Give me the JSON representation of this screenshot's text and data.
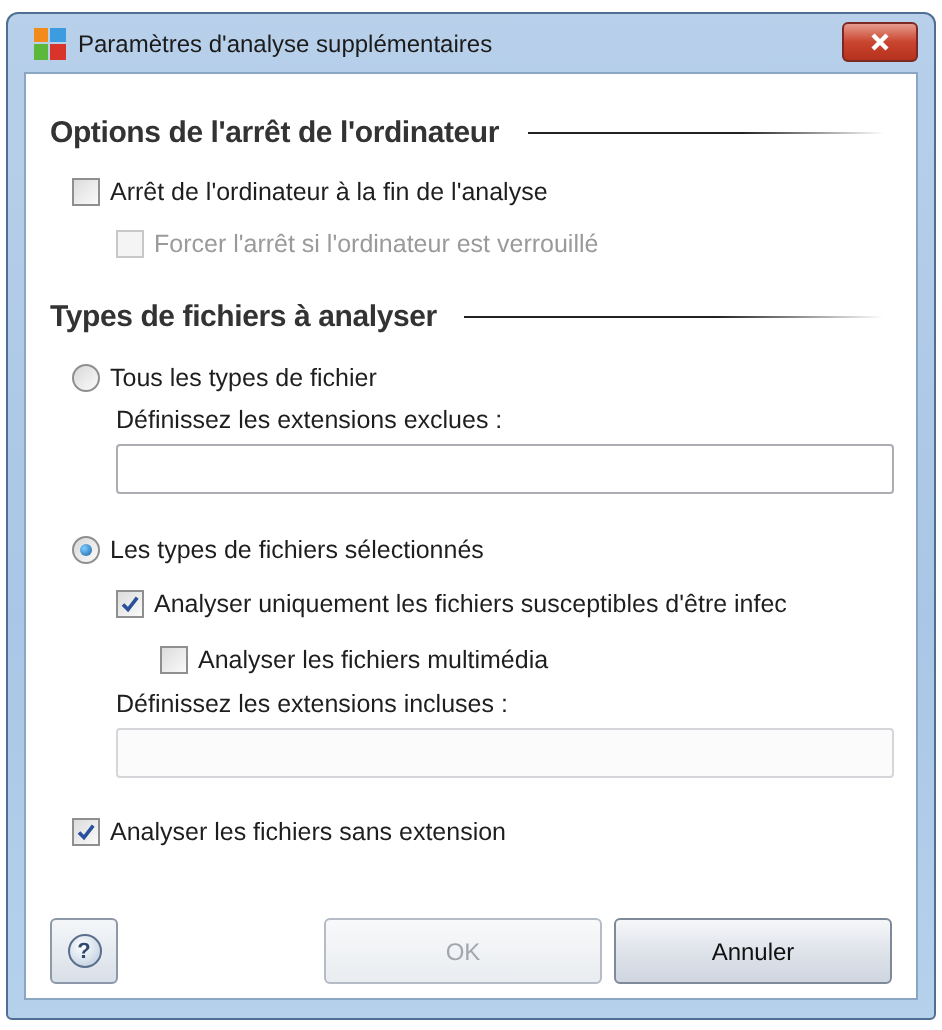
{
  "window": {
    "title": "Paramètres d'analyse supplémentaires"
  },
  "sections": [
    {
      "heading": "Options de l'arrêt de l'ordinateur",
      "items": [
        {
          "kind": "checkbox",
          "label": "Arrêt de l'ordinateur à la fin de l'analyse",
          "checked": false,
          "disabled": false,
          "children": [
            {
              "kind": "checkbox",
              "label": "Forcer l'arrêt si l'ordinateur est verrouillé",
              "checked": false,
              "disabled": true
            }
          ]
        }
      ]
    },
    {
      "heading": "Types de fichiers à analyser",
      "items": [
        {
          "kind": "radio",
          "label": "Tous les types de fichier",
          "selected": false,
          "children": [
            {
              "kind": "field",
              "label": "Définissez les extensions exclues :",
              "disabled": false
            }
          ]
        },
        {
          "kind": "radio",
          "label": "Les types de fichiers sélectionnés",
          "selected": true,
          "children": [
            {
              "kind": "checkbox",
              "label": "Analyser uniquement les fichiers susceptibles d'être infec",
              "checked": true,
              "disabled": false,
              "children": [
                {
                  "kind": "checkbox",
                  "label": "Analyser les fichiers multimédia",
                  "checked": false,
                  "disabled": false
                }
              ]
            },
            {
              "kind": "field",
              "label": "Définissez les extensions incluses :",
              "disabled": true
            }
          ]
        },
        {
          "kind": "checkbox",
          "label": "Analyser les fichiers sans extension",
          "checked": true,
          "disabled": false
        }
      ]
    }
  ],
  "help_button": {
    "symbol": "?"
  },
  "buttons": [
    {
      "label": "OK",
      "disabled": true
    },
    {
      "label": "Annuler",
      "disabled": false
    }
  ]
}
